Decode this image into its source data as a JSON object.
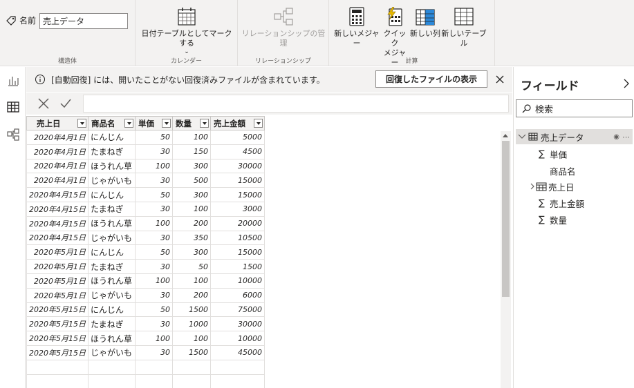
{
  "ribbon": {
    "name_label": "名前",
    "name_value": "売上データ",
    "groups": {
      "structure": "構造体",
      "calendar": "カレンダー",
      "relationships": "リレーションシップ",
      "calculations": "計算"
    },
    "buttons": {
      "mark_as_date_table": "日付テーブルとしてマークする",
      "manage_relationships": "リレーションシップの管理",
      "new_measure": "新しいメジャー",
      "quick_measure_line1": "クイック",
      "quick_measure_line2": "メジャー",
      "new_column": "新しい列",
      "new_table": "新しいテーブル"
    }
  },
  "banner": {
    "message": "[自動回復] には、開いたことがない回復済みファイルが含まれています。",
    "button_label": "回復したファイルの表示"
  },
  "table": {
    "columns": [
      "売上日",
      "商品名",
      "単価",
      "数量",
      "売上金額"
    ],
    "rows": [
      [
        "2020年4月1日",
        "にんじん",
        "50",
        "100",
        "5000"
      ],
      [
        "2020年4月1日",
        "たまねぎ",
        "30",
        "150",
        "4500"
      ],
      [
        "2020年4月1日",
        "ほうれん草",
        "100",
        "300",
        "30000"
      ],
      [
        "2020年4月1日",
        "じゃがいも",
        "30",
        "500",
        "15000"
      ],
      [
        "2020年4月15日",
        "にんじん",
        "50",
        "300",
        "15000"
      ],
      [
        "2020年4月15日",
        "たまねぎ",
        "30",
        "100",
        "3000"
      ],
      [
        "2020年4月15日",
        "ほうれん草",
        "100",
        "200",
        "20000"
      ],
      [
        "2020年4月15日",
        "じゃがいも",
        "30",
        "350",
        "10500"
      ],
      [
        "2020年5月1日",
        "にんじん",
        "50",
        "300",
        "15000"
      ],
      [
        "2020年5月1日",
        "たまねぎ",
        "30",
        "50",
        "1500"
      ],
      [
        "2020年5月1日",
        "ほうれん草",
        "100",
        "100",
        "10000"
      ],
      [
        "2020年5月1日",
        "じゃがいも",
        "30",
        "200",
        "6000"
      ],
      [
        "2020年5月15日",
        "にんじん",
        "50",
        "1500",
        "75000"
      ],
      [
        "2020年5月15日",
        "たまねぎ",
        "30",
        "1000",
        "30000"
      ],
      [
        "2020年5月15日",
        "ほうれん草",
        "100",
        "100",
        "10000"
      ],
      [
        "2020年5月15日",
        "じゃがいも",
        "30",
        "1500",
        "45000"
      ]
    ]
  },
  "fields": {
    "title": "フィールド",
    "search_label": "検索",
    "table_name": "売上データ",
    "items": [
      {
        "label": "単価",
        "kind": "sigma"
      },
      {
        "label": "商品名",
        "kind": "text"
      },
      {
        "label": "売上日",
        "kind": "date"
      },
      {
        "label": "売上金額",
        "kind": "sigma"
      },
      {
        "label": "数量",
        "kind": "sigma"
      }
    ]
  },
  "colors": {
    "accent": "#e6b800",
    "selected_view": "#252423",
    "pane_bg": "#f3f2f1"
  }
}
